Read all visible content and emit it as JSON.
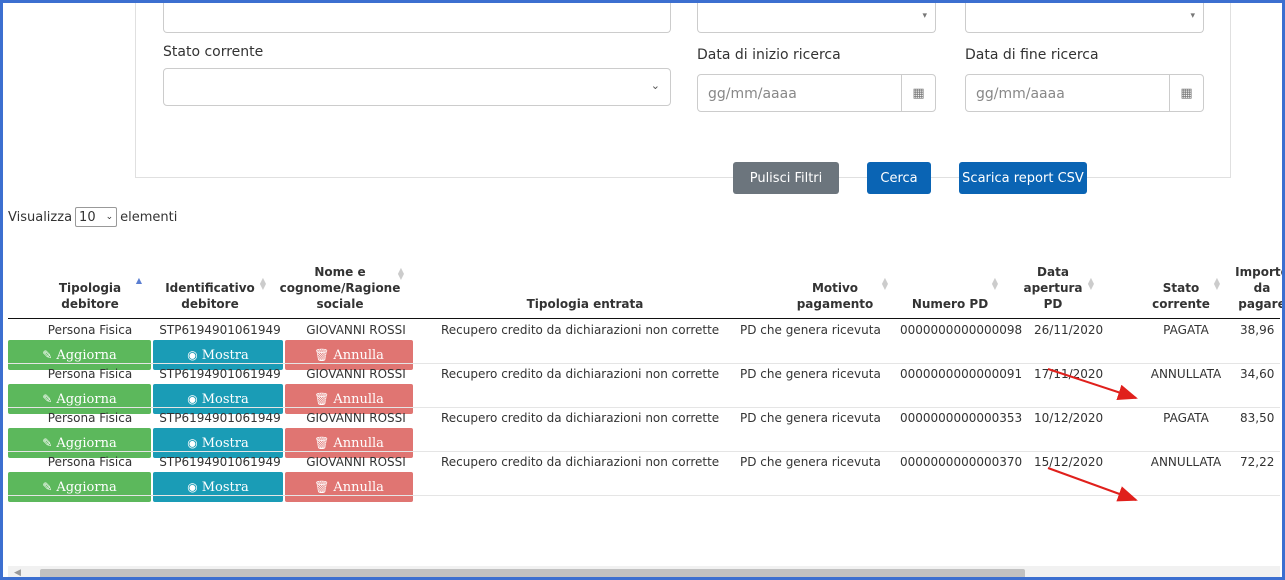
{
  "filters": {
    "stato_label": "Stato corrente",
    "stato_value": "",
    "data_inizio_label": "Data di inizio ricerca",
    "data_inizio_placeholder": "gg/mm/aaaa",
    "data_fine_label": "Data di fine ricerca",
    "data_fine_placeholder": "gg/mm/aaaa",
    "btn_pulisci": "Pulisci Filtri",
    "btn_cerca": "Cerca",
    "btn_scarica": "Scarica report CSV"
  },
  "length_menu": {
    "prefix": "Visualizza",
    "value": "10",
    "suffix": "elementi"
  },
  "table": {
    "columns": [
      "Tipologia debitore",
      "Identificativo debitore",
      "Nome e cognome/Ragione sociale",
      "Tipologia entrata",
      "Motivo pagamento",
      "Numero PD",
      "Data apertura PD",
      "Stato corrente",
      "Importo da pagare"
    ],
    "rows": [
      {
        "tipologia": "Persona Fisica",
        "id": "STP6194901061949",
        "nome": "GIOVANNI ROSSI",
        "entrata": "Recupero credito da dichiarazioni non corrette",
        "motivo": "PD che genera ricevuta",
        "numero": "0000000000000098",
        "data": "26/11/2020",
        "stato": "PAGATA",
        "importo": "38,96"
      },
      {
        "tipologia": "Persona Fisica",
        "id": "STP6194901061949",
        "nome": "GIOVANNI ROSSI",
        "entrata": "Recupero credito da dichiarazioni non corrette",
        "motivo": "PD che genera ricevuta",
        "numero": "0000000000000091",
        "data": "17/11/2020",
        "stato": "ANNULLATA",
        "importo": "34,60"
      },
      {
        "tipologia": "Persona Fisica",
        "id": "STP6194901061949",
        "nome": "GIOVANNI ROSSI",
        "entrata": "Recupero credito da dichiarazioni non corrette",
        "motivo": "PD che genera ricevuta",
        "numero": "0000000000000353",
        "data": "10/12/2020",
        "stato": "PAGATA",
        "importo": "83,50"
      },
      {
        "tipologia": "Persona Fisica",
        "id": "STP6194901061949",
        "nome": "GIOVANNI ROSSI",
        "entrata": "Recupero credito da dichiarazioni non corrette",
        "motivo": "PD che genera ricevuta",
        "numero": "0000000000000370",
        "data": "15/12/2020",
        "stato": "ANNULLATA",
        "importo": "72,22"
      }
    ],
    "actions": {
      "aggiorna": "Aggiorna",
      "mostra": "Mostra",
      "annulla": "Annulla"
    }
  },
  "colors": {
    "frame": "#3c6fd0",
    "btn_blue": "#0a64b4",
    "btn_grey": "#6c757d",
    "aggiorna": "#5cb85c",
    "mostra": "#1a9cb6",
    "annulla": "#d9534f",
    "arrow": "#e0201c"
  },
  "icons": {
    "calendar": "calendar-icon",
    "aggiorna": "edit-icon",
    "mostra": "eye-icon",
    "annulla": "trash-icon"
  }
}
